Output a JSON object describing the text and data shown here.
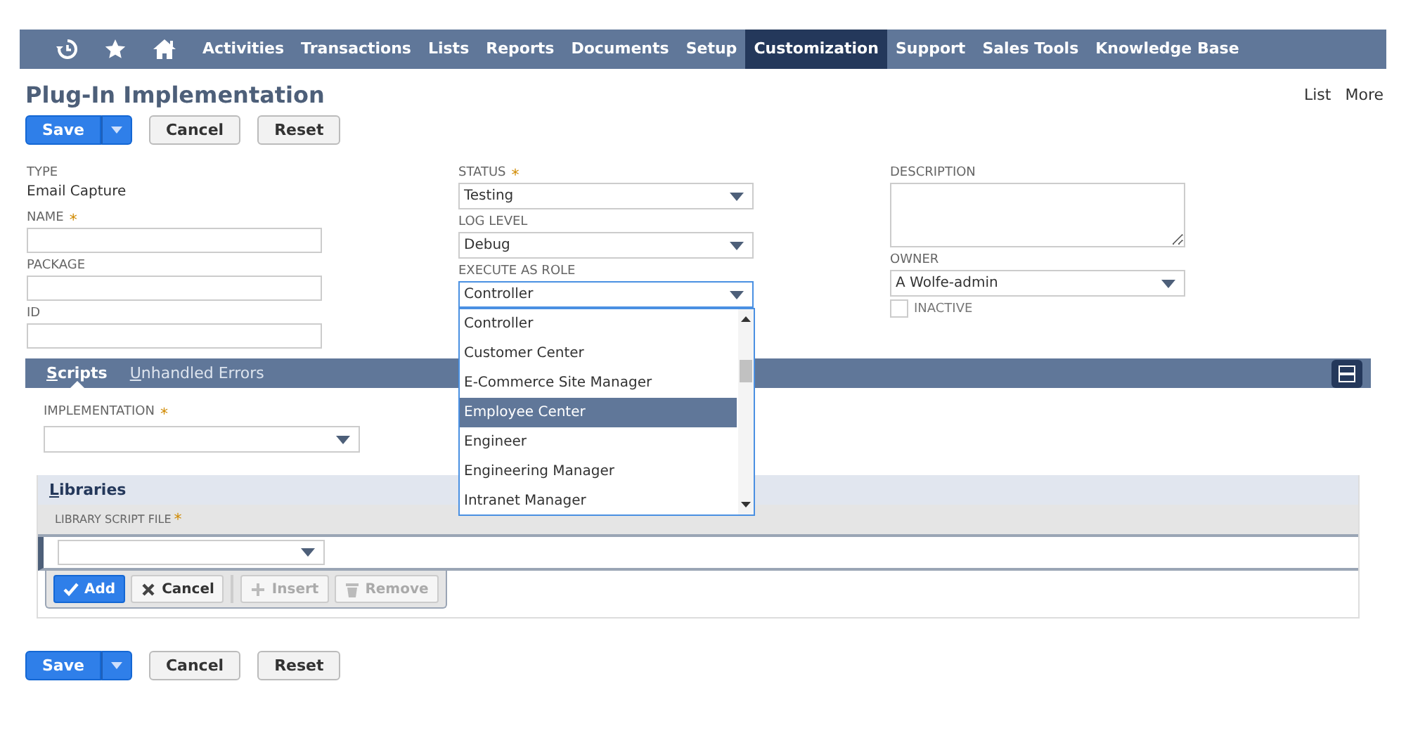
{
  "nav": {
    "items": [
      {
        "label": "Activities",
        "selected": false
      },
      {
        "label": "Transactions",
        "selected": false
      },
      {
        "label": "Lists",
        "selected": false
      },
      {
        "label": "Reports",
        "selected": false
      },
      {
        "label": "Documents",
        "selected": false
      },
      {
        "label": "Setup",
        "selected": false
      },
      {
        "label": "Customization",
        "selected": true
      },
      {
        "label": "Support",
        "selected": false
      },
      {
        "label": "Sales Tools",
        "selected": false
      },
      {
        "label": "Knowledge Base",
        "selected": false
      }
    ]
  },
  "page": {
    "title": "Plug-In Implementation",
    "links": [
      "List",
      "More"
    ]
  },
  "top_buttons": [
    {
      "label": "Save",
      "kind": "primary"
    },
    {
      "label": "Cancel",
      "kind": "plain"
    },
    {
      "label": "Reset",
      "kind": "plain"
    }
  ],
  "columns": [
    [
      {
        "kind": "static",
        "label": "TYPE",
        "value": "Email Capture"
      },
      {
        "kind": "text",
        "label": "NAME",
        "required_mark": "*"
      },
      {
        "kind": "text",
        "label": "PACKAGE"
      },
      {
        "kind": "text",
        "label": "ID"
      }
    ],
    [
      {
        "kind": "select",
        "label": "STATUS",
        "required_mark": "*",
        "value": "Testing"
      },
      {
        "kind": "select",
        "label": "LOG LEVEL",
        "value": "Debug"
      },
      {
        "kind": "select",
        "label": "EXECUTE AS ROLE",
        "value": "Controller",
        "expanded": true,
        "options": [
          {
            "label": "Controller",
            "highlighted": false
          },
          {
            "label": "Customer Center",
            "highlighted": false
          },
          {
            "label": "E-Commerce Site Manager",
            "highlighted": false
          },
          {
            "label": "Employee Center",
            "highlighted": true
          },
          {
            "label": "Engineer",
            "highlighted": false
          },
          {
            "label": "Engineering Manager",
            "highlighted": false
          },
          {
            "label": "Intranet Manager",
            "highlighted": false
          }
        ]
      }
    ],
    [
      {
        "kind": "textarea",
        "label": "DESCRIPTION"
      },
      {
        "kind": "select",
        "label": "OWNER",
        "value": "A Wolfe-admin"
      },
      {
        "kind": "checkbox",
        "label": "INACTIVE",
        "checked": false
      }
    ]
  ],
  "tabs": [
    {
      "label": "Scripts",
      "selected": true
    },
    {
      "label": "Unhandled Errors",
      "selected": false
    }
  ],
  "implementation": {
    "label": "IMPLEMENTATION",
    "required_mark": "*"
  },
  "libraries": {
    "title": "Libraries",
    "column": {
      "label": "LIBRARY SCRIPT FILE",
      "required_mark": "*"
    },
    "buttons": [
      {
        "label": "Add",
        "kind": "add",
        "disabled": false
      },
      {
        "label": "Cancel",
        "kind": "cancel",
        "disabled": false
      },
      {
        "label": "Insert",
        "kind": "insert",
        "disabled": true
      },
      {
        "label": "Remove",
        "kind": "remove",
        "disabled": true
      }
    ]
  },
  "bottom_buttons": [
    {
      "label": "Save",
      "kind": "primary"
    },
    {
      "label": "Cancel",
      "kind": "plain"
    },
    {
      "label": "Reset",
      "kind": "plain"
    }
  ]
}
